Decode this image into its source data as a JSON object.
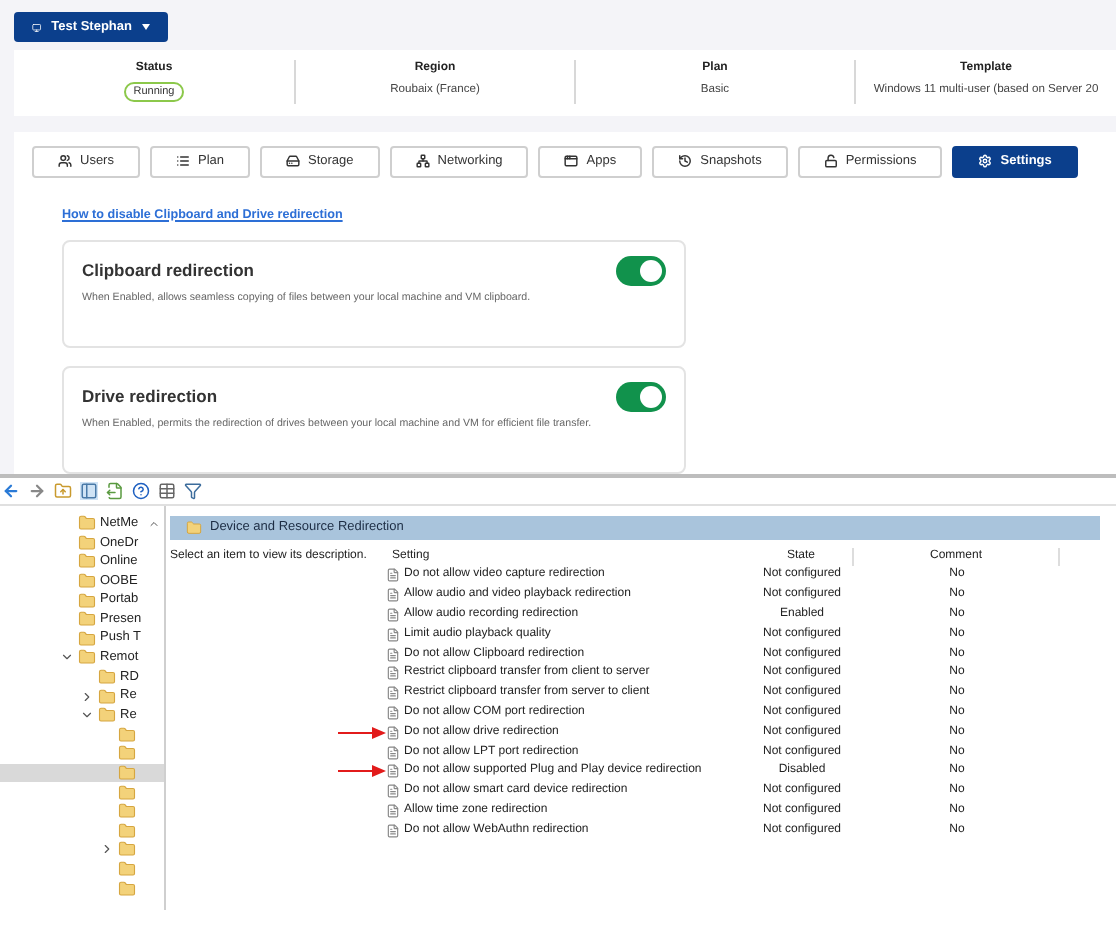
{
  "vm_button": {
    "label": "Test Stephan"
  },
  "info": [
    {
      "label": "Status",
      "value": "Running",
      "kind": "badge"
    },
    {
      "label": "Region",
      "value": "Roubaix (France)",
      "kind": "text"
    },
    {
      "label": "Plan",
      "value": "Basic",
      "kind": "text"
    },
    {
      "label": "Template",
      "value": "Windows 11 multi-user (based on Server 20",
      "kind": "text"
    }
  ],
  "tabs": [
    {
      "label": "Users",
      "selected": false
    },
    {
      "label": "Plan",
      "selected": false
    },
    {
      "label": "Storage",
      "selected": false
    },
    {
      "label": "Networking",
      "selected": false
    },
    {
      "label": "Apps",
      "selected": false
    },
    {
      "label": "Snapshots",
      "selected": false
    },
    {
      "label": "Permissions",
      "selected": false
    },
    {
      "label": "Settings",
      "selected": true
    }
  ],
  "help_link": "How to disable Clipboard and Drive redirection",
  "settings": [
    {
      "title": "Clipboard redirection",
      "description": "When Enabled, allows seamless copying of files between your local machine and VM clipboard.",
      "on": true
    },
    {
      "title": "Drive redirection",
      "description": "When Enabled, permits the redirection of drives between your local machine and VM for efficient file transfer.",
      "on": true
    }
  ],
  "tree": [
    {
      "label": "NetMe",
      "selected": false
    },
    {
      "label": "OneDr",
      "selected": false
    },
    {
      "label": "Online",
      "selected": false
    },
    {
      "label": "OOBE",
      "selected": false
    },
    {
      "label": "Portab",
      "selected": false
    },
    {
      "label": "Presen",
      "selected": false
    },
    {
      "label": "Push T",
      "selected": false
    },
    {
      "label": "Remot",
      "selected": false,
      "expanded": true,
      "children": [
        {
          "label": "RD",
          "selected": false
        },
        {
          "label": "Re",
          "selected": false,
          "expanded": false
        },
        {
          "label": "Re",
          "selected": false,
          "expanded": true,
          "children": [
            {
              "selected": false
            },
            {
              "selected": false
            },
            {
              "selected": true
            },
            {
              "selected": false
            },
            {
              "selected": false
            },
            {
              "selected": false
            },
            {
              "selected": false,
              "expanded": false
            },
            {
              "selected": false
            },
            {
              "selected": false
            }
          ]
        }
      ]
    }
  ],
  "pane_title": "Device and Resource Redirection",
  "description": "Select an item to view its description.",
  "columns": [
    "Setting",
    "State",
    "Comment"
  ],
  "rows": [
    {
      "setting": "Do not allow video capture redirection",
      "state": "Not configured",
      "comment": "No",
      "marked": false
    },
    {
      "setting": "Allow audio and video playback redirection",
      "state": "Not configured",
      "comment": "No",
      "marked": false
    },
    {
      "setting": "Allow audio recording redirection",
      "state": "Enabled",
      "comment": "No",
      "marked": false
    },
    {
      "setting": "Limit audio playback quality",
      "state": "Not configured",
      "comment": "No",
      "marked": false
    },
    {
      "setting": "Do not allow Clipboard redirection",
      "state": "Not configured",
      "comment": "No",
      "marked": false
    },
    {
      "setting": "Restrict clipboard transfer from client to server",
      "state": "Not configured",
      "comment": "No",
      "marked": false
    },
    {
      "setting": "Restrict clipboard transfer from server to client",
      "state": "Not configured",
      "comment": "No",
      "marked": false
    },
    {
      "setting": "Do not allow COM port redirection",
      "state": "Not configured",
      "comment": "No",
      "marked": false
    },
    {
      "setting": "Do not allow drive redirection",
      "state": "Not configured",
      "comment": "No",
      "marked": true
    },
    {
      "setting": "Do not allow LPT port redirection",
      "state": "Not configured",
      "comment": "No",
      "marked": false
    },
    {
      "setting": "Do not allow supported Plug and Play device redirection",
      "state": "Disabled",
      "comment": "No",
      "marked": true
    },
    {
      "setting": "Do not allow smart card device redirection",
      "state": "Not configured",
      "comment": "No",
      "marked": false
    },
    {
      "setting": "Allow time zone redirection",
      "state": "Not configured",
      "comment": "No",
      "marked": false
    },
    {
      "setting": "Do not allow WebAuthn redirection",
      "state": "Not configured",
      "comment": "No",
      "marked": false
    }
  ]
}
